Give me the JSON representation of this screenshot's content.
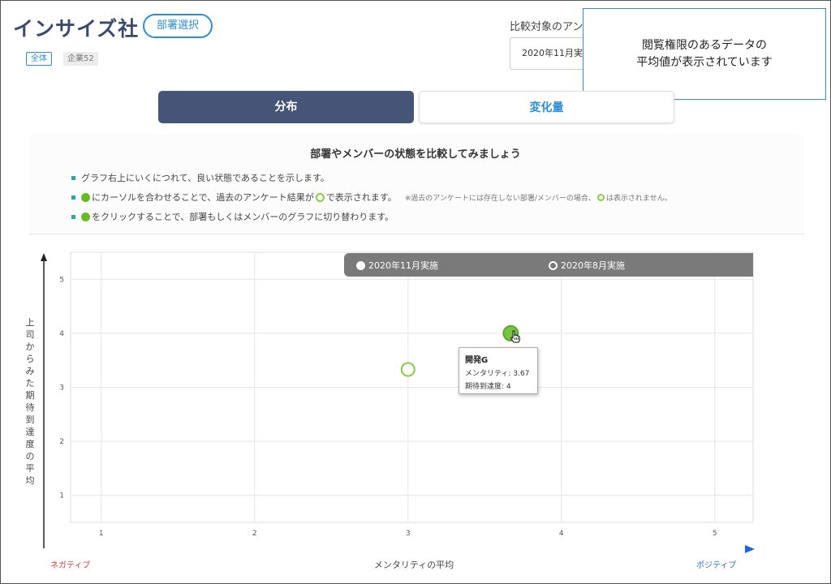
{
  "header": {
    "company": "インサイズ社",
    "dept_button": "部署選択",
    "tag_all": "全体",
    "tag_company": "企業52",
    "compare_label": "比較対象のアン",
    "compare_select": "2020年11月実"
  },
  "callout": {
    "line1": "閲覧権限のあるデータの",
    "line2": "平均値が表示されています"
  },
  "tabs": [
    {
      "label": "分布",
      "active": true
    },
    {
      "label": "変化量",
      "active": false
    }
  ],
  "info": {
    "heading": "部署やメンバーの状態を比較してみましょう",
    "bullet1": "グラフ右上にいくにつれて、良い状態であることを示します。",
    "bullet2_a": "にカーソルを合わせることで、過去のアンケート結果が",
    "bullet2_b": "で表示されます。",
    "bullet2_note_a": "※過去のアンケートには存在しない部署/メンバーの場合、",
    "bullet2_note_b": "は表示されません。",
    "bullet3": "をクリックすることで、部署もしくはメンバーのグラフに切り替わります。"
  },
  "chart_data": {
    "type": "scatter",
    "xlabel": "メンタリティの平均",
    "ylabel": "上司からみた期待到達度の平均",
    "xlim": [
      0.8,
      5.25
    ],
    "ylim": [
      0.5,
      5.5
    ],
    "x_ticks": [
      1,
      2,
      3,
      4,
      5
    ],
    "y_ticks": [
      1,
      2,
      3,
      4,
      5
    ],
    "grid": true,
    "low_label": "ネガティブ",
    "high_label": "ポジティブ",
    "legend": [
      {
        "name": "2020年11月実施",
        "marker": "filled"
      },
      {
        "name": "2020年8月実施",
        "marker": "hollow"
      }
    ],
    "series": [
      {
        "name": "2020年11月実施",
        "points": [
          {
            "x": 3.67,
            "y": 4
          }
        ]
      },
      {
        "name": "2020年8月実施",
        "points": [
          {
            "x": 3.0,
            "y": 3.33
          }
        ]
      }
    ],
    "colors": {
      "current": "#76c442",
      "current_edge": "#5aa82c",
      "past": "#88cc44"
    },
    "tooltip": {
      "name": "開発G",
      "line1": "メンタリティ: 3.67",
      "line2": "期待到達度: 4"
    }
  }
}
